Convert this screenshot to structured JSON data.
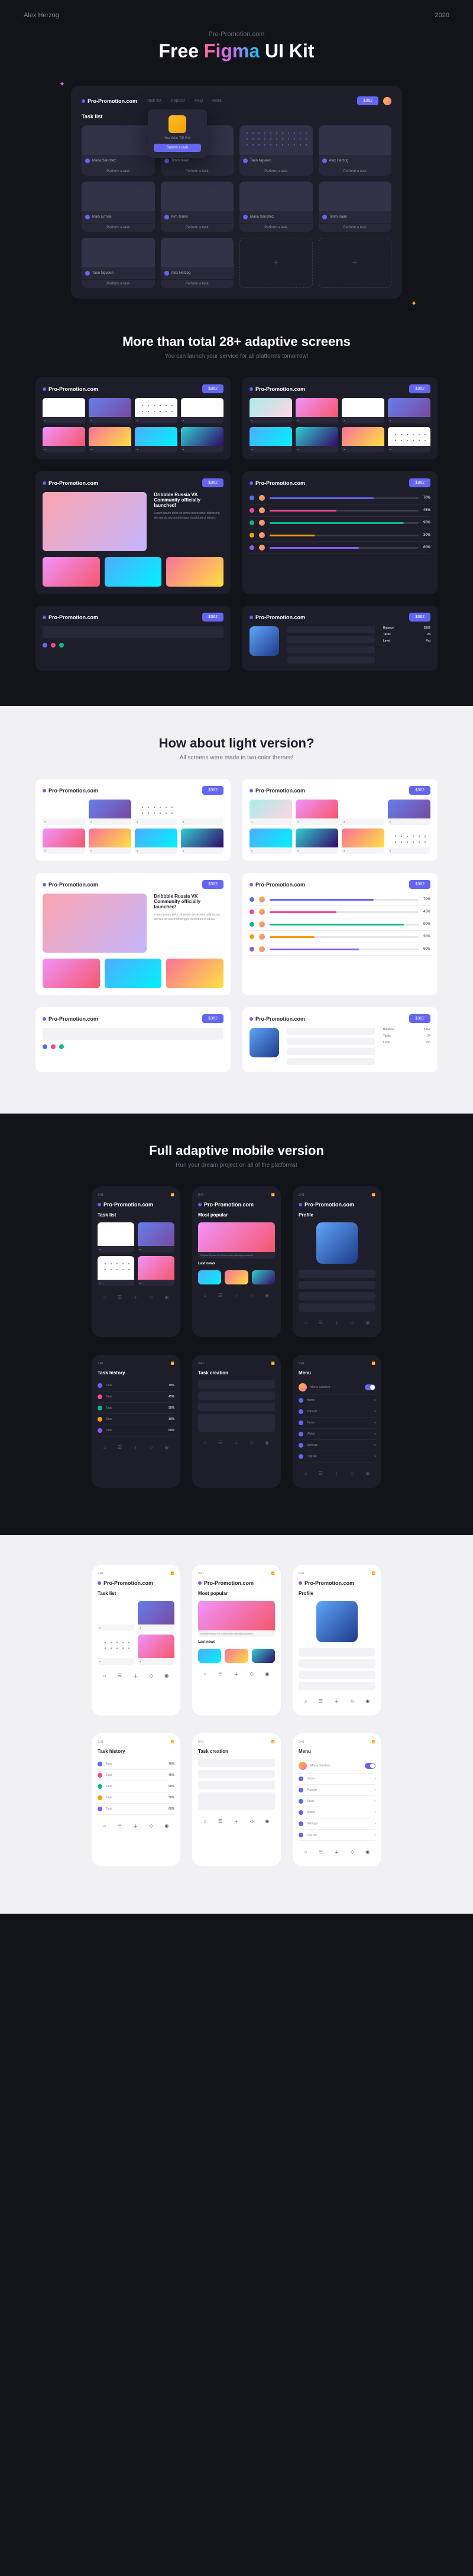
{
  "meta": {
    "author": "Alex Herzog",
    "year": "2020"
  },
  "hero": {
    "sub": "Pro-Promotion.com",
    "title_prefix": "Free ",
    "title_grad": "Figma",
    "title_suffix": " UI Kit"
  },
  "hero_screen": {
    "logo": "Pro-Promotion.com",
    "nav": [
      "Task list",
      "Popular",
      "FAQ",
      "More"
    ],
    "btn": "$362",
    "heading": "Task list",
    "popup_text": "You Won 7$! Go!",
    "popup_btn": "Submit a task",
    "card_action": "Perform a task",
    "users": [
      "Maria Sanchez",
      "Timm Kaan",
      "Taen Ngueen",
      "Alex Herzog",
      "Mark Ermak",
      "Kim Torres"
    ],
    "empty": "+"
  },
  "section1": {
    "title": "More than total 28+ adaptive screens",
    "sub": "You can launch your service for all platforms tomorrow!"
  },
  "feature": {
    "title": "Dribbble Russia VK Community officially launched!",
    "body": "Lorem ipsum dolor sit amet consectetur adipiscing elit sed do eiusmod tempor incididunt ut labore.",
    "last": "Last news"
  },
  "table": {
    "rows": [
      {
        "pct": 70,
        "c": "#6366f1"
      },
      {
        "pct": 45,
        "c": "#ec4899"
      },
      {
        "pct": 90,
        "c": "#10b981"
      },
      {
        "pct": 30,
        "c": "#f59e0b"
      },
      {
        "pct": 60,
        "c": "#8b5cf6"
      }
    ]
  },
  "profile": {
    "title": "Profile",
    "stats_labels": [
      "Balance",
      "Tasks",
      "Level"
    ],
    "stats_values": [
      "$362",
      "24",
      "Pro"
    ]
  },
  "section2": {
    "title": "How about light version?",
    "sub": "All screens were made in two color themes!"
  },
  "section3": {
    "title": "Full adaptive mobile version",
    "sub": "Run your dream project on all of the platforms!"
  },
  "mobile": {
    "status_time": "9:41",
    "logo": "Pro-Promotion.com",
    "screens": {
      "tasklist": "Task list",
      "popular": "Most popular",
      "profile": "Profile",
      "history": "Task history",
      "creation": "Task creation",
      "menu": "Menu"
    },
    "news": "Last news",
    "menu_items": [
      "Home",
      "Popular",
      "Tasks",
      "Wallet",
      "Settings",
      "Log out"
    ]
  },
  "colors": {
    "accent": "#6366f1",
    "pink": "#ec4899",
    "green": "#10b981",
    "amber": "#f59e0b",
    "purple": "#8b5cf6"
  }
}
